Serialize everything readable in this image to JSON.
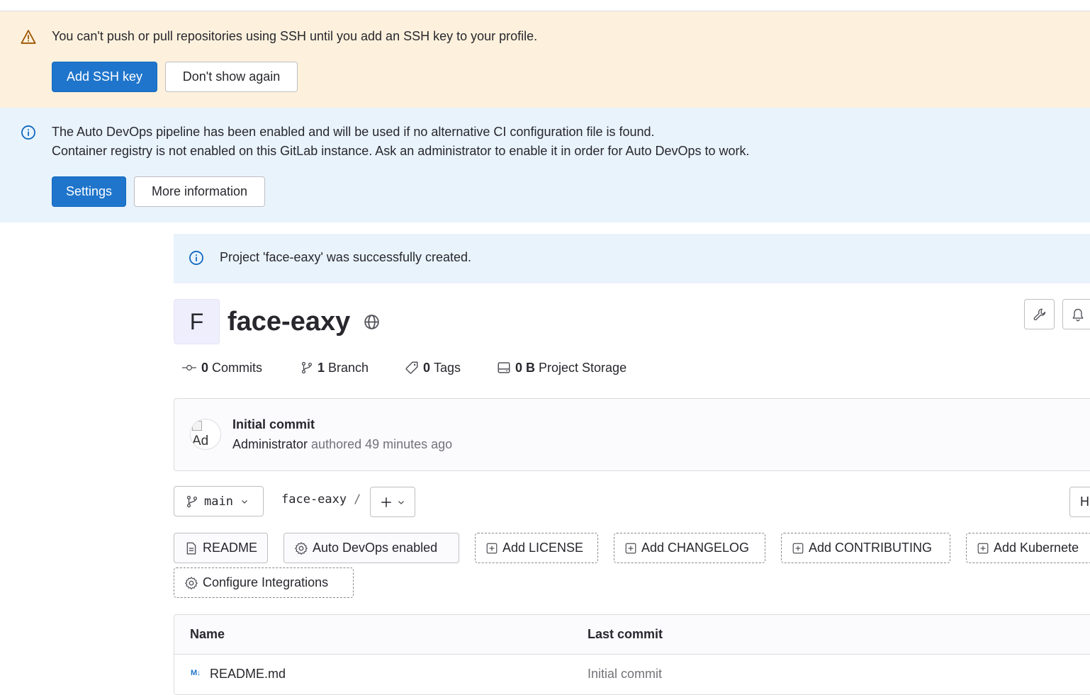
{
  "ssh_banner": {
    "message": "You can't push or pull repositories using SSH until you add an SSH key to your profile.",
    "primary_button": "Add SSH key",
    "secondary_button": "Don't show again"
  },
  "devops_banner": {
    "line1": "The Auto DevOps pipeline has been enabled and will be used if no alternative CI configuration file is found.",
    "line2": "Container registry is not enabled on this GitLab instance. Ask an administrator to enable it in order for Auto DevOps to work.",
    "primary_button": "Settings",
    "secondary_button": "More information"
  },
  "success_alert": {
    "message": "Project 'face-eaxy' was successfully created."
  },
  "project": {
    "avatar_letter": "F",
    "name": "face-eaxy",
    "visibility_icon": "globe-icon"
  },
  "stats": {
    "commits_count": "0",
    "commits_label": "Commits",
    "branch_count": "1",
    "branch_label": "Branch",
    "tags_count": "0",
    "tags_label": "Tags",
    "storage_count": "0 B",
    "storage_label": "Project Storage"
  },
  "last_commit": {
    "avatar_alt": "Ad",
    "title": "Initial commit",
    "author": "Administrator",
    "meta": "authored 49 minutes ago"
  },
  "toolbar": {
    "branch": "main",
    "path_root": "face-eaxy",
    "path_sep": "/",
    "history_label": "H"
  },
  "shortcuts": {
    "readme": "README",
    "auto_devops": "Auto DevOps enabled",
    "add_license": "Add LICENSE",
    "add_changelog": "Add CHANGELOG",
    "add_contributing": "Add CONTRIBUTING",
    "add_kubernetes": "Add Kubernete",
    "configure_integrations": "Configure Integrations"
  },
  "file_table": {
    "col_name": "Name",
    "col_last_commit": "Last commit",
    "rows": [
      {
        "icon": "M↓",
        "name": "README.md",
        "last_commit": "Initial commit"
      }
    ]
  },
  "colors": {
    "primary": "#1f75cb",
    "warning_bg": "#fdf1dd",
    "info_bg": "#e9f3fc",
    "text": "#28272d",
    "muted": "#737278"
  }
}
